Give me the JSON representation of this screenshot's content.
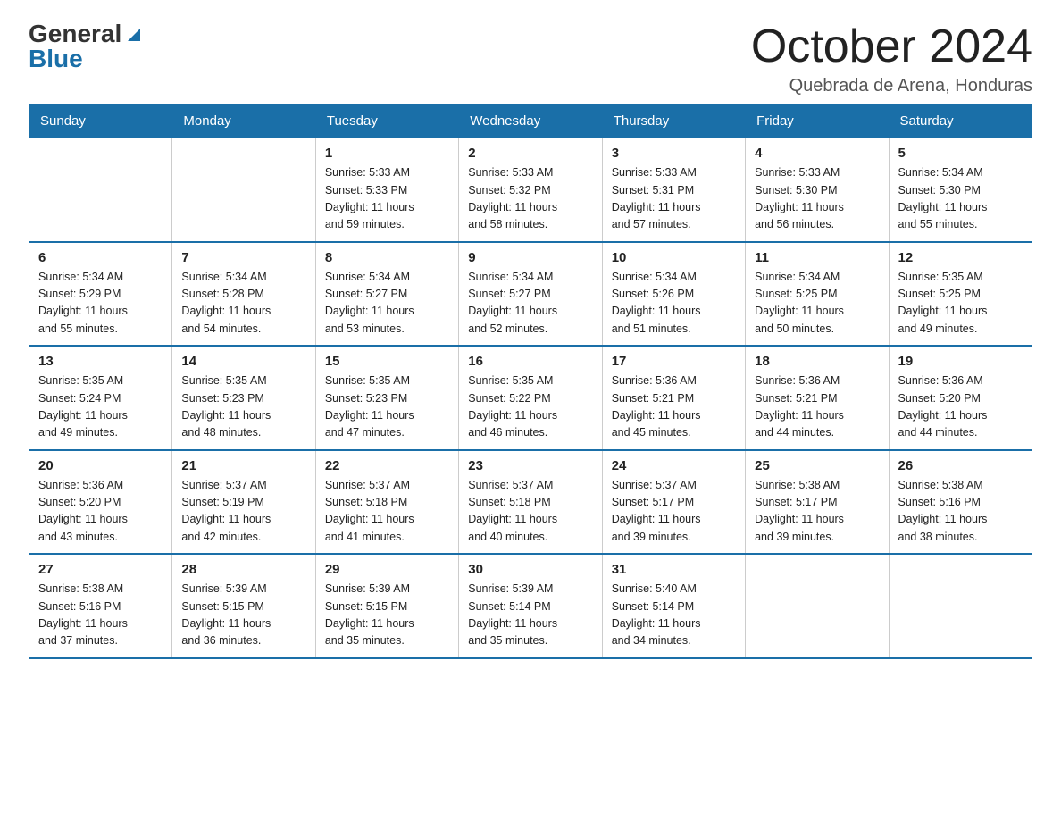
{
  "header": {
    "logo_general": "General",
    "logo_blue": "Blue",
    "month_title": "October 2024",
    "location": "Quebrada de Arena, Honduras"
  },
  "weekdays": [
    "Sunday",
    "Monday",
    "Tuesday",
    "Wednesday",
    "Thursday",
    "Friday",
    "Saturday"
  ],
  "weeks": [
    [
      {
        "day": "",
        "info": ""
      },
      {
        "day": "",
        "info": ""
      },
      {
        "day": "1",
        "info": "Sunrise: 5:33 AM\nSunset: 5:33 PM\nDaylight: 11 hours\nand 59 minutes."
      },
      {
        "day": "2",
        "info": "Sunrise: 5:33 AM\nSunset: 5:32 PM\nDaylight: 11 hours\nand 58 minutes."
      },
      {
        "day": "3",
        "info": "Sunrise: 5:33 AM\nSunset: 5:31 PM\nDaylight: 11 hours\nand 57 minutes."
      },
      {
        "day": "4",
        "info": "Sunrise: 5:33 AM\nSunset: 5:30 PM\nDaylight: 11 hours\nand 56 minutes."
      },
      {
        "day": "5",
        "info": "Sunrise: 5:34 AM\nSunset: 5:30 PM\nDaylight: 11 hours\nand 55 minutes."
      }
    ],
    [
      {
        "day": "6",
        "info": "Sunrise: 5:34 AM\nSunset: 5:29 PM\nDaylight: 11 hours\nand 55 minutes."
      },
      {
        "day": "7",
        "info": "Sunrise: 5:34 AM\nSunset: 5:28 PM\nDaylight: 11 hours\nand 54 minutes."
      },
      {
        "day": "8",
        "info": "Sunrise: 5:34 AM\nSunset: 5:27 PM\nDaylight: 11 hours\nand 53 minutes."
      },
      {
        "day": "9",
        "info": "Sunrise: 5:34 AM\nSunset: 5:27 PM\nDaylight: 11 hours\nand 52 minutes."
      },
      {
        "day": "10",
        "info": "Sunrise: 5:34 AM\nSunset: 5:26 PM\nDaylight: 11 hours\nand 51 minutes."
      },
      {
        "day": "11",
        "info": "Sunrise: 5:34 AM\nSunset: 5:25 PM\nDaylight: 11 hours\nand 50 minutes."
      },
      {
        "day": "12",
        "info": "Sunrise: 5:35 AM\nSunset: 5:25 PM\nDaylight: 11 hours\nand 49 minutes."
      }
    ],
    [
      {
        "day": "13",
        "info": "Sunrise: 5:35 AM\nSunset: 5:24 PM\nDaylight: 11 hours\nand 49 minutes."
      },
      {
        "day": "14",
        "info": "Sunrise: 5:35 AM\nSunset: 5:23 PM\nDaylight: 11 hours\nand 48 minutes."
      },
      {
        "day": "15",
        "info": "Sunrise: 5:35 AM\nSunset: 5:23 PM\nDaylight: 11 hours\nand 47 minutes."
      },
      {
        "day": "16",
        "info": "Sunrise: 5:35 AM\nSunset: 5:22 PM\nDaylight: 11 hours\nand 46 minutes."
      },
      {
        "day": "17",
        "info": "Sunrise: 5:36 AM\nSunset: 5:21 PM\nDaylight: 11 hours\nand 45 minutes."
      },
      {
        "day": "18",
        "info": "Sunrise: 5:36 AM\nSunset: 5:21 PM\nDaylight: 11 hours\nand 44 minutes."
      },
      {
        "day": "19",
        "info": "Sunrise: 5:36 AM\nSunset: 5:20 PM\nDaylight: 11 hours\nand 44 minutes."
      }
    ],
    [
      {
        "day": "20",
        "info": "Sunrise: 5:36 AM\nSunset: 5:20 PM\nDaylight: 11 hours\nand 43 minutes."
      },
      {
        "day": "21",
        "info": "Sunrise: 5:37 AM\nSunset: 5:19 PM\nDaylight: 11 hours\nand 42 minutes."
      },
      {
        "day": "22",
        "info": "Sunrise: 5:37 AM\nSunset: 5:18 PM\nDaylight: 11 hours\nand 41 minutes."
      },
      {
        "day": "23",
        "info": "Sunrise: 5:37 AM\nSunset: 5:18 PM\nDaylight: 11 hours\nand 40 minutes."
      },
      {
        "day": "24",
        "info": "Sunrise: 5:37 AM\nSunset: 5:17 PM\nDaylight: 11 hours\nand 39 minutes."
      },
      {
        "day": "25",
        "info": "Sunrise: 5:38 AM\nSunset: 5:17 PM\nDaylight: 11 hours\nand 39 minutes."
      },
      {
        "day": "26",
        "info": "Sunrise: 5:38 AM\nSunset: 5:16 PM\nDaylight: 11 hours\nand 38 minutes."
      }
    ],
    [
      {
        "day": "27",
        "info": "Sunrise: 5:38 AM\nSunset: 5:16 PM\nDaylight: 11 hours\nand 37 minutes."
      },
      {
        "day": "28",
        "info": "Sunrise: 5:39 AM\nSunset: 5:15 PM\nDaylight: 11 hours\nand 36 minutes."
      },
      {
        "day": "29",
        "info": "Sunrise: 5:39 AM\nSunset: 5:15 PM\nDaylight: 11 hours\nand 35 minutes."
      },
      {
        "day": "30",
        "info": "Sunrise: 5:39 AM\nSunset: 5:14 PM\nDaylight: 11 hours\nand 35 minutes."
      },
      {
        "day": "31",
        "info": "Sunrise: 5:40 AM\nSunset: 5:14 PM\nDaylight: 11 hours\nand 34 minutes."
      },
      {
        "day": "",
        "info": ""
      },
      {
        "day": "",
        "info": ""
      }
    ]
  ]
}
